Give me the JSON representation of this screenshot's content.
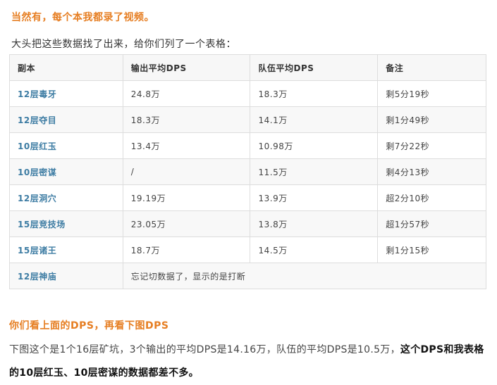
{
  "header": {
    "title": "当然有，每个本我都录了视频。",
    "intro": "大头把这些数据找了出来，给你们列了一个表格："
  },
  "table": {
    "columns": [
      "副本",
      "输出平均DPS",
      "队伍平均DPS",
      "备注"
    ],
    "rows": [
      {
        "dungeon": "12层毒牙",
        "output_dps": "24.8万",
        "team_dps": "18.3万",
        "note": "剩5分19秒"
      },
      {
        "dungeon": "12层夺目",
        "output_dps": "18.3万",
        "team_dps": "14.1万",
        "note": "剩1分49秒"
      },
      {
        "dungeon": "10层红玉",
        "output_dps": "13.4万",
        "team_dps": "10.98万",
        "note": "剩7分22秒"
      },
      {
        "dungeon": "10层密谋",
        "output_dps": "/",
        "team_dps": "11.5万",
        "note": "剩4分13秒"
      },
      {
        "dungeon": "12层洞穴",
        "output_dps": "19.19万",
        "team_dps": "13.9万",
        "note": "超2分10秒"
      },
      {
        "dungeon": "15层竞技场",
        "output_dps": "23.05万",
        "team_dps": "13.8万",
        "note": "超1分57秒"
      },
      {
        "dungeon": "15层诸王",
        "output_dps": "18.7万",
        "team_dps": "14.5万",
        "note": "剩1分15秒"
      },
      {
        "dungeon": "12层神庙",
        "merged_note": "忘记切数据了，显示的是打断"
      }
    ]
  },
  "section2": {
    "title": "你们看上面的DPS，再看下图DPS",
    "para_normal": "下图这个是1个16层矿坑，3个输出的平均DPS是14.16万，队伍的平均DPS是10.5万，",
    "para_bold": "这个DPS和我表格的10层红玉、10层密谋的数据都差不多。"
  },
  "colors": {
    "accent_orange": "#e67e22",
    "dungeon_blue": "#3d7ca3"
  }
}
